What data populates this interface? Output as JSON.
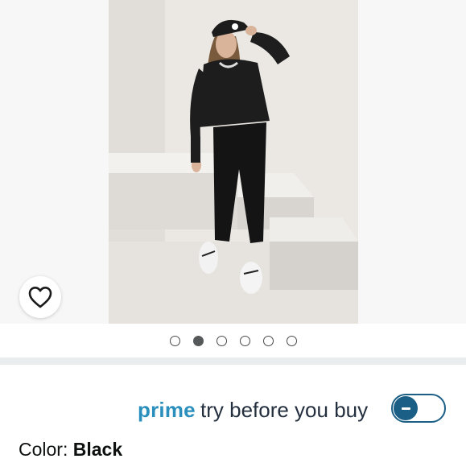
{
  "gallery": {
    "image_alt": "Woman wearing black sweatshirt and black jogger pants with white sneakers and black cap",
    "dots_count": 6,
    "active_dot_index": 1
  },
  "wishlist": {
    "icon": "heart-outline-icon"
  },
  "prime": {
    "brand_label": "prime",
    "tagline": "try before you buy",
    "toggle_state": "off"
  },
  "color": {
    "label": "Color: ",
    "value": "Black"
  },
  "colors": {
    "prime_blue": "#2a8fbd",
    "toggle_blue": "#1c5f86",
    "text": "#0f1111"
  }
}
